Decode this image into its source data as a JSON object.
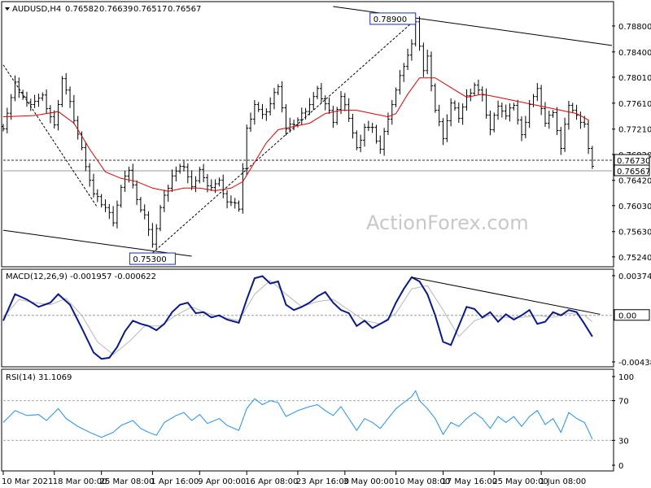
{
  "chart_data": [
    {
      "type": "candlestick",
      "header": {
        "symbol": "AUDUSD,H4",
        "open": "0.76582",
        "high": "0.76639",
        "low": "0.76517",
        "close": "0.76567"
      },
      "watermark": "ActionForex.com",
      "x_ticks": [
        "10 Mar 2021",
        "18 Mar 00:00",
        "25 Mar 08:00",
        "1 Apr 16:00",
        "9 Apr 00:00",
        "16 Apr 08:00",
        "23 Apr 16:00",
        "3 May 00:00",
        "10 May 08:00",
        "17 May 16:00",
        "25 May 00:00",
        "1 Jun 08:00"
      ],
      "y_ticks": [
        "0.78800",
        "0.78400",
        "0.78010",
        "0.77610",
        "0.77210",
        "0.76820",
        "0.76420",
        "0.76030",
        "0.75630",
        "0.75240"
      ],
      "ylim": [
        0.751,
        0.7915
      ],
      "price_tags": [
        "0.76730",
        "0.76567"
      ],
      "level_lines": [
        0.7673,
        0.76567
      ],
      "annotations": [
        {
          "text": "0.78900",
          "x_index": 105,
          "price": 0.789
        },
        {
          "text": "0.75300",
          "x_index": 38,
          "price": 0.753
        }
      ],
      "ma_label": "moving average (red)",
      "close_path": [
        [
          0,
          0.7725
        ],
        [
          3,
          0.779
        ],
        [
          6,
          0.776
        ],
        [
          10,
          0.777
        ],
        [
          13,
          0.7725
        ],
        [
          15,
          0.78
        ],
        [
          17,
          0.776
        ],
        [
          20,
          0.769
        ],
        [
          23,
          0.762
        ],
        [
          26,
          0.76
        ],
        [
          28,
          0.758
        ],
        [
          30,
          0.763
        ],
        [
          32,
          0.766
        ],
        [
          34,
          0.761
        ],
        [
          36,
          0.759
        ],
        [
          38,
          0.754
        ],
        [
          40,
          0.76
        ],
        [
          43,
          0.765
        ],
        [
          46,
          0.7665
        ],
        [
          48,
          0.763
        ],
        [
          50,
          0.766
        ],
        [
          52,
          0.763
        ],
        [
          55,
          0.764
        ],
        [
          57,
          0.761
        ],
        [
          60,
          0.76
        ],
        [
          62,
          0.772
        ],
        [
          64,
          0.776
        ],
        [
          66,
          0.774
        ],
        [
          68,
          0.776
        ],
        [
          70,
          0.779
        ],
        [
          72,
          0.772
        ],
        [
          75,
          0.7735
        ],
        [
          78,
          0.776
        ],
        [
          80,
          0.778
        ],
        [
          82,
          0.776
        ],
        [
          84,
          0.7735
        ],
        [
          86,
          0.777
        ],
        [
          88,
          0.774
        ],
        [
          90,
          0.769
        ],
        [
          92,
          0.7725
        ],
        [
          94,
          0.772
        ],
        [
          96,
          0.769
        ],
        [
          98,
          0.774
        ],
        [
          100,
          0.778
        ],
        [
          102,
          0.782
        ],
        [
          104,
          0.785
        ],
        [
          105,
          0.789
        ],
        [
          106,
          0.785
        ],
        [
          107,
          0.781
        ],
        [
          108,
          0.783
        ],
        [
          109,
          0.779
        ],
        [
          110,
          0.775
        ],
        [
          112,
          0.771
        ],
        [
          114,
          0.776
        ],
        [
          116,
          0.774
        ],
        [
          118,
          0.777
        ],
        [
          120,
          0.779
        ],
        [
          122,
          0.777
        ],
        [
          124,
          0.772
        ],
        [
          126,
          0.776
        ],
        [
          128,
          0.774
        ],
        [
          130,
          0.776
        ],
        [
          132,
          0.771
        ],
        [
          134,
          0.776
        ],
        [
          136,
          0.778
        ],
        [
          138,
          0.773
        ],
        [
          140,
          0.775
        ],
        [
          142,
          0.769
        ],
        [
          144,
          0.776
        ],
        [
          146,
          0.774
        ],
        [
          148,
          0.773
        ],
        [
          149,
          0.769
        ],
        [
          150,
          0.766
        ]
      ],
      "ma_path": [
        [
          0,
          0.774
        ],
        [
          8,
          0.7742
        ],
        [
          14,
          0.7748
        ],
        [
          18,
          0.773
        ],
        [
          22,
          0.769
        ],
        [
          26,
          0.7655
        ],
        [
          30,
          0.7645
        ],
        [
          34,
          0.764
        ],
        [
          38,
          0.763
        ],
        [
          42,
          0.7625
        ],
        [
          46,
          0.763
        ],
        [
          50,
          0.763
        ],
        [
          54,
          0.7626
        ],
        [
          58,
          0.763
        ],
        [
          61,
          0.764
        ],
        [
          64,
          0.767
        ],
        [
          67,
          0.77
        ],
        [
          70,
          0.772
        ],
        [
          74,
          0.7725
        ],
        [
          78,
          0.773
        ],
        [
          82,
          0.7745
        ],
        [
          86,
          0.775
        ],
        [
          90,
          0.775
        ],
        [
          94,
          0.7745
        ],
        [
          98,
          0.774
        ],
        [
          100,
          0.7745
        ],
        [
          103,
          0.7775
        ],
        [
          106,
          0.78
        ],
        [
          110,
          0.78
        ],
        [
          114,
          0.7785
        ],
        [
          118,
          0.777
        ],
        [
          122,
          0.7775
        ],
        [
          126,
          0.777
        ],
        [
          130,
          0.7765
        ],
        [
          134,
          0.776
        ],
        [
          138,
          0.7755
        ],
        [
          142,
          0.775
        ],
        [
          146,
          0.7745
        ],
        [
          149,
          0.7735
        ]
      ],
      "trendlines": [
        {
          "from": [
            0,
            0.782
          ],
          "to": [
            24,
            0.76
          ],
          "style": "dashed"
        },
        {
          "from": [
            38,
            0.753
          ],
          "to": [
            105,
            0.789
          ],
          "style": "dashed"
        },
        {
          "from": [
            0,
            0.7565
          ],
          "to": [
            48,
            0.7525
          ],
          "style": "solid"
        },
        {
          "from": [
            84,
            0.791
          ],
          "to": [
            155,
            0.785
          ],
          "style": "solid"
        }
      ]
    },
    {
      "type": "line",
      "title": "MACD(12,26,9) -0.001957 -0.000622",
      "y_ticks": [
        "0.003742",
        "0.00",
        "-0.004389"
      ],
      "ylim": [
        -0.0047,
        0.0042
      ],
      "zero_tag": "0.00",
      "main_path": [
        [
          0,
          -0.0005
        ],
        [
          3,
          0.002
        ],
        [
          6,
          0.0015
        ],
        [
          9,
          0.0008
        ],
        [
          12,
          0.0012
        ],
        [
          14,
          0.002
        ],
        [
          17,
          0.001
        ],
        [
          20,
          -0.0012
        ],
        [
          23,
          -0.0035
        ],
        [
          25,
          -0.0041
        ],
        [
          27,
          -0.004
        ],
        [
          29,
          -0.003
        ],
        [
          31,
          -0.0015
        ],
        [
          33,
          -0.0005
        ],
        [
          35,
          -0.0008
        ],
        [
          37,
          -0.001
        ],
        [
          39,
          -0.0014
        ],
        [
          41,
          -0.0008
        ],
        [
          43,
          0.0003
        ],
        [
          45,
          0.001
        ],
        [
          47,
          0.0012
        ],
        [
          49,
          0.0002
        ],
        [
          51,
          0.0003
        ],
        [
          53,
          -0.0002
        ],
        [
          55,
          0.0
        ],
        [
          57,
          -0.0004
        ],
        [
          60,
          -0.0007
        ],
        [
          62,
          0.0015
        ],
        [
          64,
          0.0035
        ],
        [
          66,
          0.0037
        ],
        [
          68,
          0.003
        ],
        [
          70,
          0.0032
        ],
        [
          72,
          0.001
        ],
        [
          74,
          0.0005
        ],
        [
          76,
          0.0008
        ],
        [
          78,
          0.0012
        ],
        [
          80,
          0.0018
        ],
        [
          82,
          0.0022
        ],
        [
          84,
          0.0012
        ],
        [
          86,
          0.0005
        ],
        [
          88,
          0.0002
        ],
        [
          90,
          -0.001
        ],
        [
          92,
          -0.0005
        ],
        [
          94,
          -0.0012
        ],
        [
          96,
          -0.0008
        ],
        [
          98,
          -0.0004
        ],
        [
          100,
          0.0012
        ],
        [
          102,
          0.0025
        ],
        [
          104,
          0.0036
        ],
        [
          106,
          0.0032
        ],
        [
          108,
          0.002
        ],
        [
          110,
          0.0
        ],
        [
          112,
          -0.0025
        ],
        [
          114,
          -0.0028
        ],
        [
          116,
          -0.001
        ],
        [
          118,
          0.0008
        ],
        [
          120,
          0.0006
        ],
        [
          122,
          -0.0002
        ],
        [
          124,
          0.0003
        ],
        [
          126,
          -0.0006
        ],
        [
          128,
          0.0001
        ],
        [
          130,
          -0.0004
        ],
        [
          132,
          0.0
        ],
        [
          134,
          0.0005
        ],
        [
          136,
          -0.0008
        ],
        [
          138,
          -0.0006
        ],
        [
          140,
          0.0003
        ],
        [
          142,
          0.0
        ],
        [
          144,
          0.0005
        ],
        [
          146,
          0.0003
        ],
        [
          148,
          -0.0008
        ],
        [
          150,
          -0.002
        ]
      ],
      "signal_path": [
        [
          0,
          -0.0002
        ],
        [
          4,
          0.0015
        ],
        [
          8,
          0.0012
        ],
        [
          12,
          0.001
        ],
        [
          16,
          0.0016
        ],
        [
          20,
          0.0
        ],
        [
          24,
          -0.0025
        ],
        [
          28,
          -0.0037
        ],
        [
          32,
          -0.0025
        ],
        [
          36,
          -0.001
        ],
        [
          40,
          -0.001
        ],
        [
          44,
          0.0
        ],
        [
          48,
          0.0008
        ],
        [
          52,
          0.0002
        ],
        [
          56,
          -0.0002
        ],
        [
          60,
          -0.0005
        ],
        [
          64,
          0.002
        ],
        [
          68,
          0.0033
        ],
        [
          72,
          0.002
        ],
        [
          76,
          0.0008
        ],
        [
          80,
          0.0013
        ],
        [
          84,
          0.0015
        ],
        [
          88,
          0.0005
        ],
        [
          92,
          -0.0005
        ],
        [
          96,
          -0.0008
        ],
        [
          100,
          0.0002
        ],
        [
          104,
          0.0025
        ],
        [
          108,
          0.0028
        ],
        [
          112,
          0.0005
        ],
        [
          116,
          -0.002
        ],
        [
          120,
          -0.0005
        ],
        [
          124,
          0.0
        ],
        [
          128,
          -0.0002
        ],
        [
          132,
          -0.0002
        ],
        [
          136,
          0.0
        ],
        [
          140,
          -0.0002
        ],
        [
          144,
          0.0002
        ],
        [
          148,
          0.0
        ],
        [
          150,
          -0.0006
        ]
      ],
      "trendline": {
        "from": [
          104,
          0.0036
        ],
        "to": [
          152,
          0.0001
        ]
      }
    },
    {
      "type": "line",
      "title": "RSI(14) 31.1069",
      "y_ticks": [
        "100",
        "70",
        "30",
        "0"
      ],
      "levels": [
        70,
        30
      ],
      "ylim": [
        0,
        100
      ],
      "path": [
        [
          0,
          48
        ],
        [
          3,
          60
        ],
        [
          6,
          55
        ],
        [
          9,
          56
        ],
        [
          11,
          50
        ],
        [
          14,
          62
        ],
        [
          16,
          52
        ],
        [
          19,
          44
        ],
        [
          22,
          38
        ],
        [
          25,
          33
        ],
        [
          28,
          38
        ],
        [
          30,
          45
        ],
        [
          33,
          50
        ],
        [
          35,
          42
        ],
        [
          37,
          38
        ],
        [
          39,
          35
        ],
        [
          41,
          48
        ],
        [
          44,
          55
        ],
        [
          46,
          58
        ],
        [
          48,
          50
        ],
        [
          50,
          56
        ],
        [
          52,
          47
        ],
        [
          55,
          52
        ],
        [
          57,
          45
        ],
        [
          60,
          40
        ],
        [
          62,
          62
        ],
        [
          64,
          72
        ],
        [
          66,
          66
        ],
        [
          68,
          70
        ],
        [
          70,
          68
        ],
        [
          72,
          54
        ],
        [
          75,
          60
        ],
        [
          78,
          64
        ],
        [
          80,
          66
        ],
        [
          82,
          60
        ],
        [
          84,
          55
        ],
        [
          86,
          64
        ],
        [
          88,
          52
        ],
        [
          90,
          40
        ],
        [
          92,
          52
        ],
        [
          94,
          48
        ],
        [
          96,
          42
        ],
        [
          98,
          52
        ],
        [
          100,
          62
        ],
        [
          102,
          68
        ],
        [
          104,
          74
        ],
        [
          105,
          80
        ],
        [
          106,
          70
        ],
        [
          108,
          62
        ],
        [
          110,
          52
        ],
        [
          112,
          36
        ],
        [
          114,
          48
        ],
        [
          116,
          44
        ],
        [
          118,
          52
        ],
        [
          120,
          58
        ],
        [
          122,
          52
        ],
        [
          124,
          42
        ],
        [
          126,
          54
        ],
        [
          128,
          48
        ],
        [
          130,
          54
        ],
        [
          132,
          44
        ],
        [
          134,
          54
        ],
        [
          136,
          60
        ],
        [
          138,
          46
        ],
        [
          140,
          52
        ],
        [
          142,
          38
        ],
        [
          144,
          58
        ],
        [
          146,
          52
        ],
        [
          148,
          48
        ],
        [
          149,
          40
        ],
        [
          150,
          31
        ]
      ]
    }
  ]
}
